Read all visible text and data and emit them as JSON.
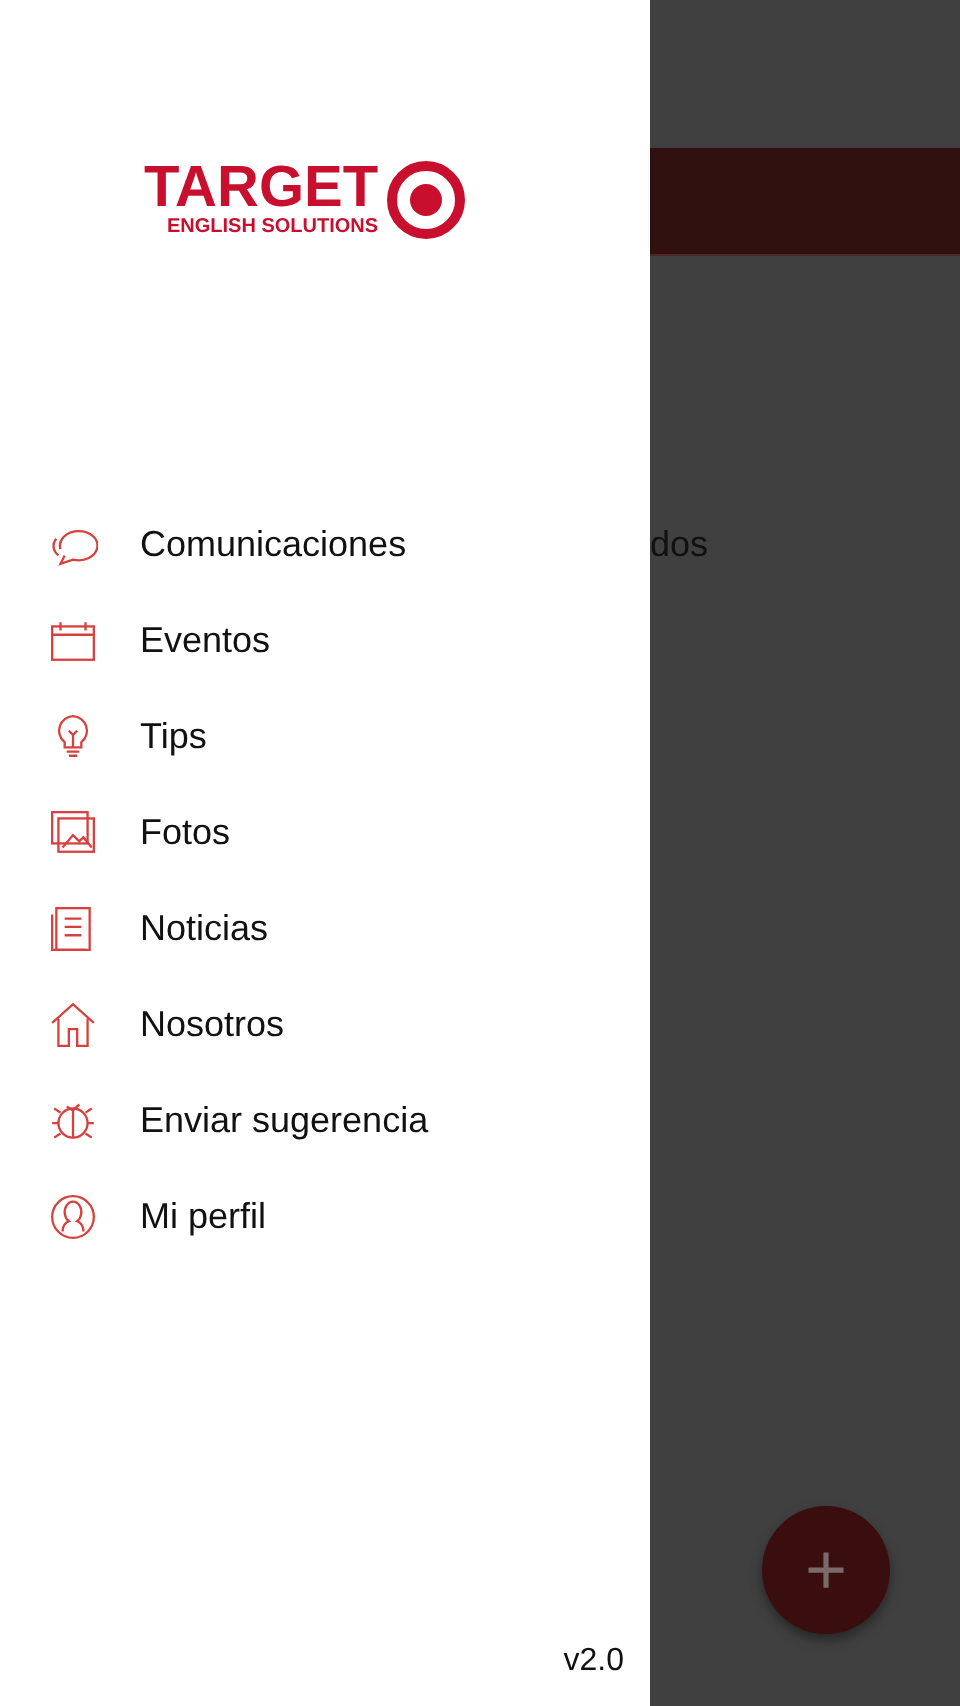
{
  "drawer": {
    "logo": {
      "title": "TARGET",
      "subtitle": "ENGLISH SOLUTIONS"
    },
    "items": [
      {
        "kind": "chat",
        "label": "Comunicaciones"
      },
      {
        "kind": "calendar",
        "label": "Eventos"
      },
      {
        "kind": "bulb",
        "label": "Tips"
      },
      {
        "kind": "photos",
        "label": "Fotos"
      },
      {
        "kind": "news",
        "label": "Noticias"
      },
      {
        "kind": "home",
        "label": "Nosotros"
      },
      {
        "kind": "bug",
        "label": "Enviar sugerencia"
      },
      {
        "kind": "user",
        "label": "Mi perfil"
      }
    ],
    "version": "v2.0"
  },
  "background": {
    "text": "dos",
    "fab": "+"
  }
}
